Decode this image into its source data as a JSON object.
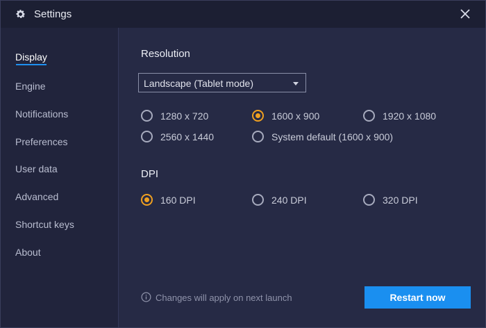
{
  "window": {
    "title": "Settings",
    "icons": {
      "app": "gear-icon",
      "close": "close-icon"
    }
  },
  "sidebar": {
    "items": [
      {
        "label": "Display",
        "active": true
      },
      {
        "label": "Engine",
        "active": false
      },
      {
        "label": "Notifications",
        "active": false
      },
      {
        "label": "Preferences",
        "active": false
      },
      {
        "label": "User data",
        "active": false
      },
      {
        "label": "Advanced",
        "active": false
      },
      {
        "label": "Shortcut keys",
        "active": false
      },
      {
        "label": "About",
        "active": false
      }
    ]
  },
  "resolution": {
    "title": "Resolution",
    "mode_select": {
      "value": "Landscape (Tablet mode)"
    },
    "options": [
      {
        "label": "1280 x 720",
        "checked": false
      },
      {
        "label": "1600 x 900",
        "checked": true
      },
      {
        "label": "1920 x 1080",
        "checked": false
      },
      {
        "label": "2560 x 1440",
        "checked": false
      },
      {
        "label": "System default (1600 x 900)",
        "checked": false
      }
    ]
  },
  "dpi": {
    "title": "DPI",
    "options": [
      {
        "label": "160 DPI",
        "checked": true
      },
      {
        "label": "240 DPI",
        "checked": false
      },
      {
        "label": "320 DPI",
        "checked": false
      }
    ]
  },
  "footer": {
    "note": "Changes will apply on next launch",
    "note_icon": "info-icon",
    "restart_label": "Restart now"
  },
  "colors": {
    "accent_blue": "#1a8ff0",
    "radio_selected": "#f0a020",
    "background": "#262a45"
  }
}
